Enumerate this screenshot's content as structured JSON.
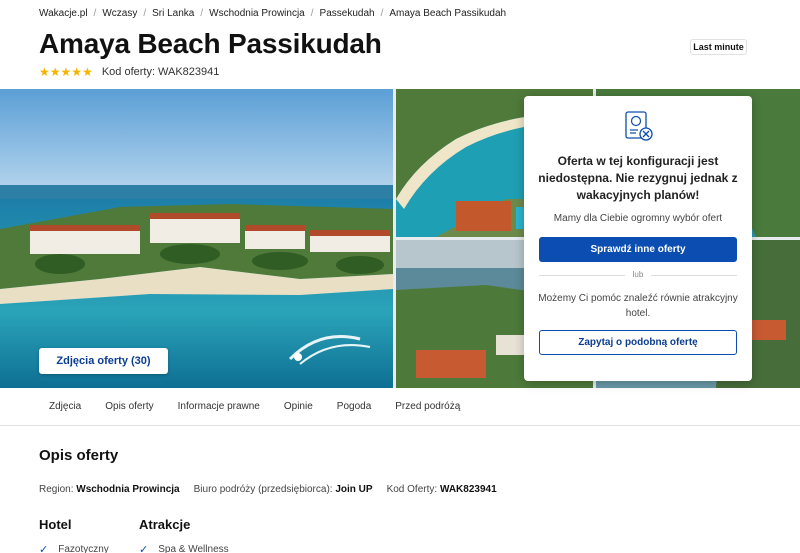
{
  "breadcrumb": [
    "Wakacje.pl",
    "Wczasy",
    "Sri Lanka",
    "Wschodnia Prowincja",
    "Passekudah",
    "Amaya Beach Passikudah"
  ],
  "breadcrumb_separator": "/",
  "hotel": {
    "name": "Amaya Beach Passikudah",
    "badge": "Last minute",
    "stars": 5,
    "star_glyph": "★",
    "star_color": "#f5b400",
    "offer_code_label": "Kod oferty:",
    "offer_code": "WAK823941"
  },
  "gallery": {
    "photos_button": "Zdjęcia oferty (30)"
  },
  "offer_card": {
    "icon": "document-cancel-icon",
    "heading": "Oferta w tej konfiguracji jest niedostępna. Nie rezygnuj jednak z wakacyjnych planów!",
    "subtext": "Mamy dla Ciebie ogromny wybór ofert",
    "primary_button": "Sprawdź inne oferty",
    "or_label": "lub",
    "help_text": "Możemy Ci pomóc znaleźć równie atrakcyjny hotel.",
    "secondary_button": "Zapytaj o podobną ofertę"
  },
  "tabs": [
    "Zdjęcia",
    "Opis oferty",
    "Informacje prawne",
    "Opinie",
    "Pogoda",
    "Przed podróżą"
  ],
  "description": {
    "title": "Opis oferty",
    "meta": [
      {
        "label": "Region:",
        "value": "Wschodnia Prowincja"
      },
      {
        "label": "Biuro podróży (przedsiębiorca):",
        "value": "Join UP"
      },
      {
        "label": "Kod Oferty:",
        "value": "WAK823941"
      }
    ],
    "columns": [
      {
        "heading": "Hotel",
        "items": [
          "Fazotyczny"
        ]
      },
      {
        "heading": "Atrakcje",
        "items": [
          "Spa & Wellness"
        ]
      }
    ]
  },
  "colors": {
    "primary": "#0b4db0",
    "accent_text": "#0b3d91"
  }
}
